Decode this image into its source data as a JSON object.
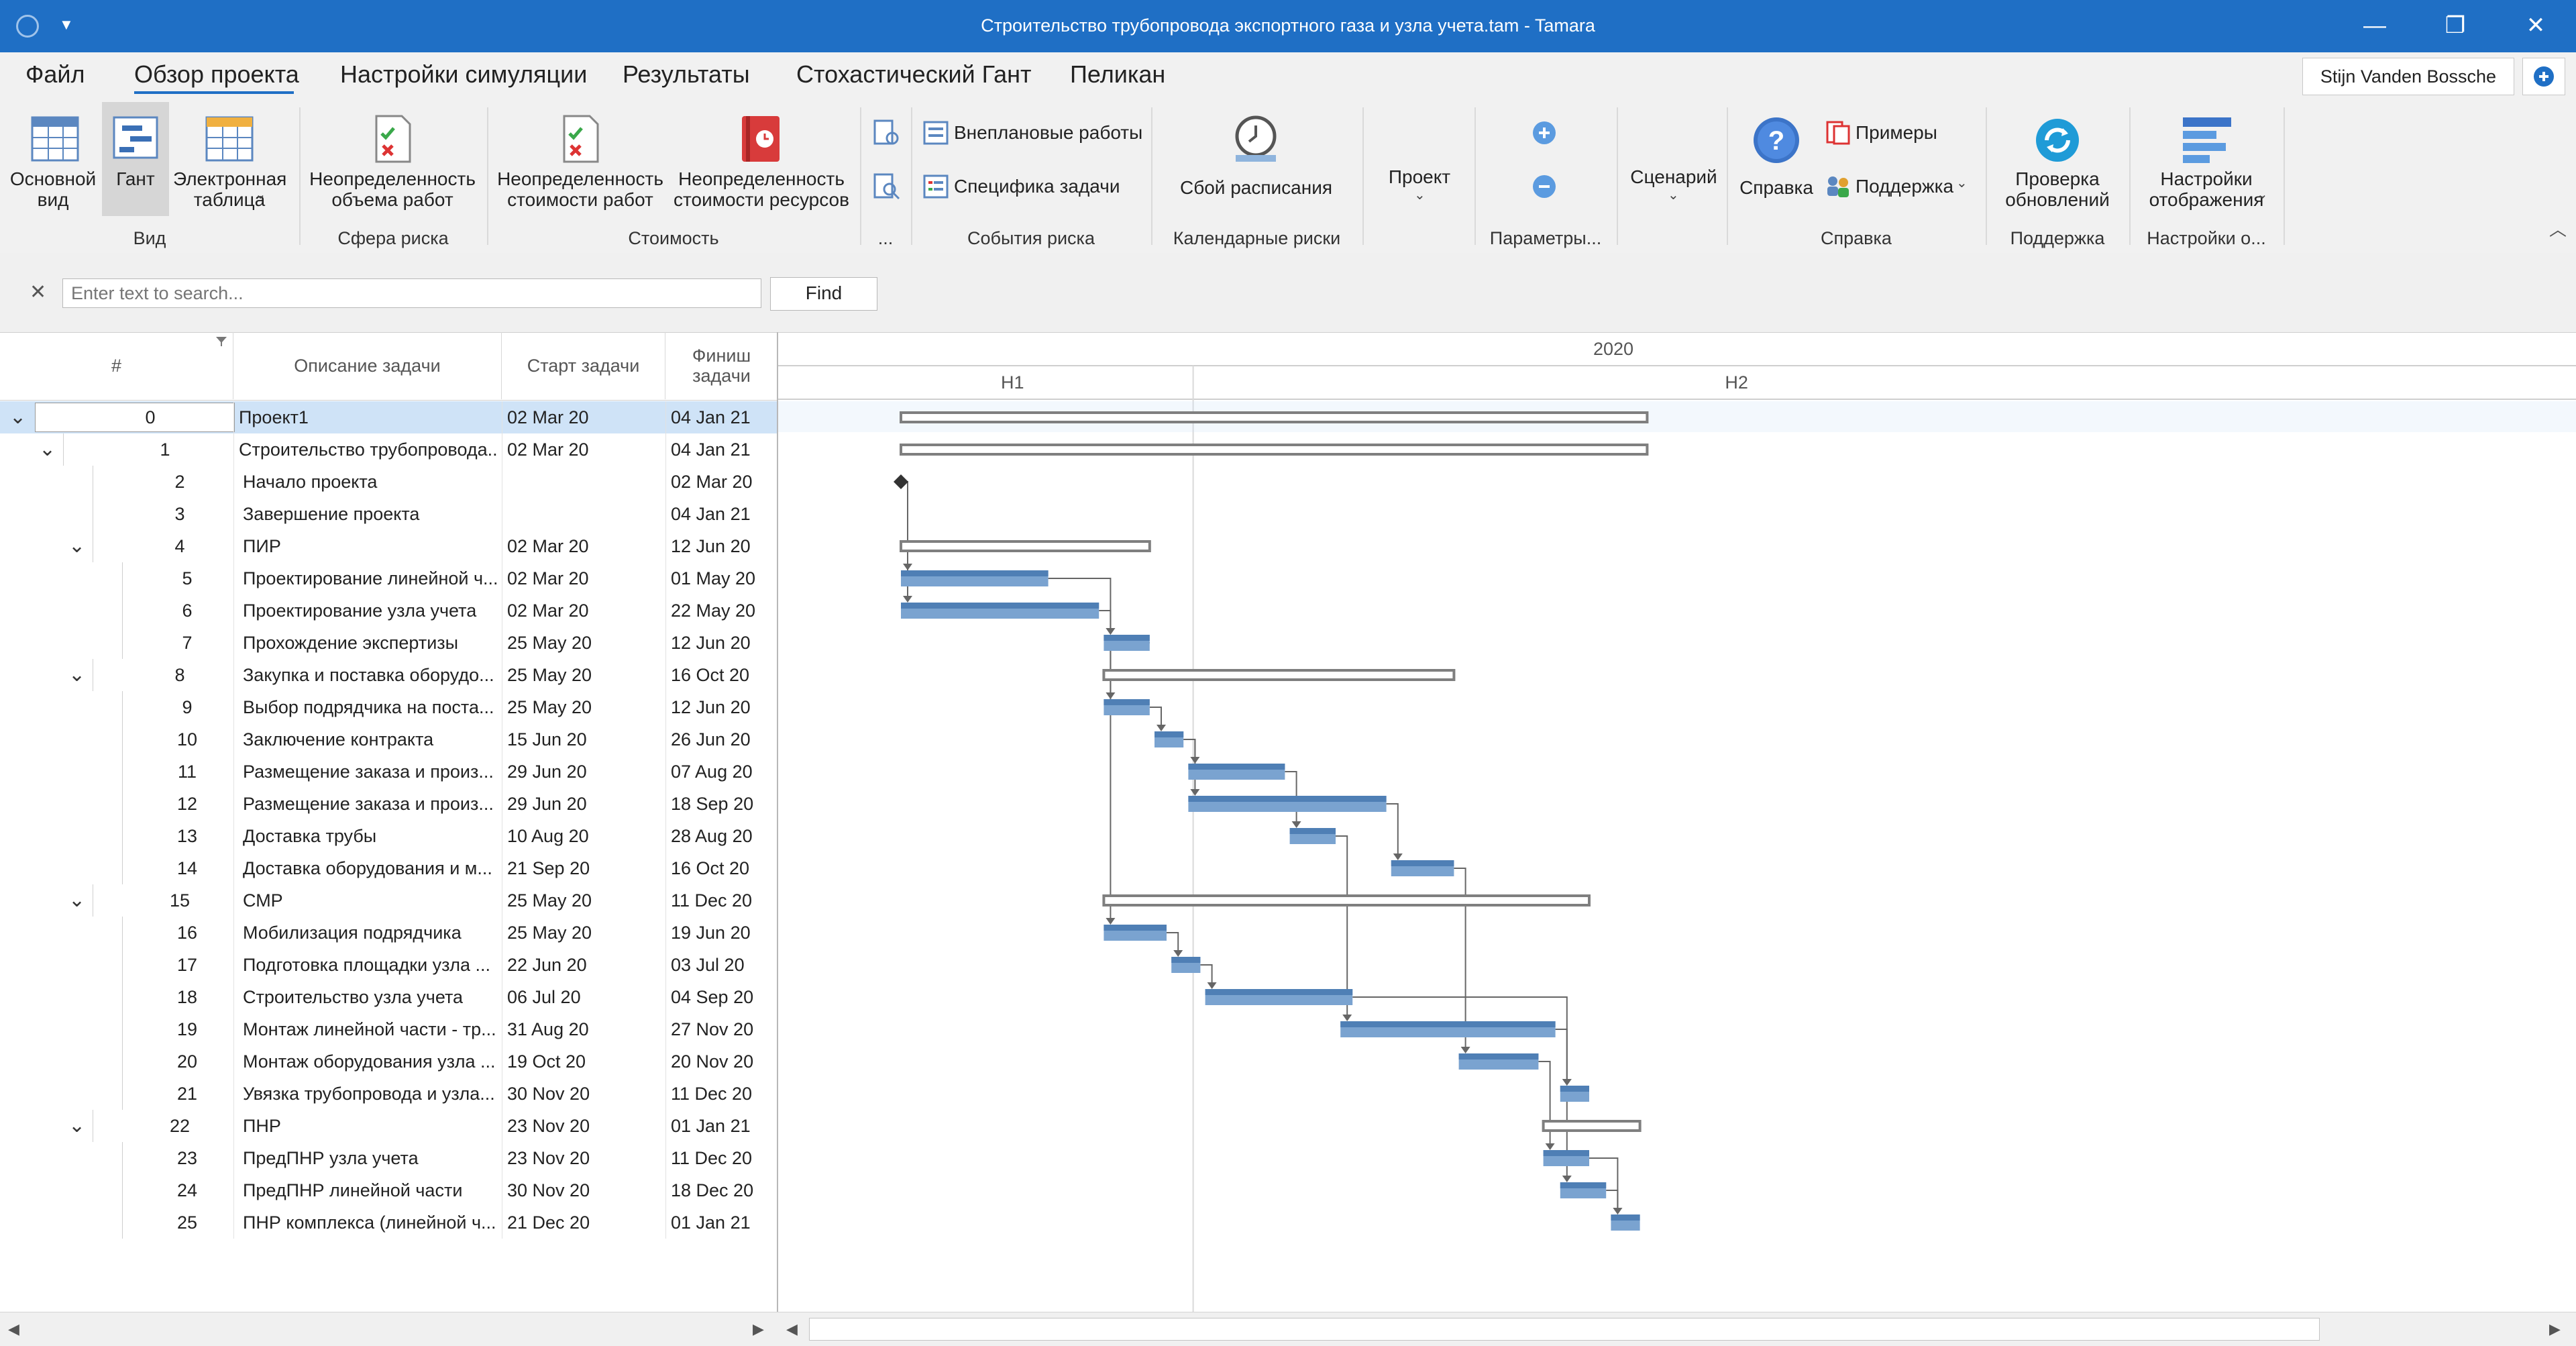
{
  "window": {
    "title": "Строительство трубопровода экспортного газа и узла учета.tam - Tamara",
    "minimize": "—",
    "restore": "❐",
    "close": "✕"
  },
  "menu": {
    "items": [
      "Файл",
      "Обзор проекта",
      "Настройки симуляции",
      "Результаты",
      "Стохастический Гант",
      "Пеликан"
    ],
    "active": "Обзор проекта",
    "user": "Stijn Vanden Bossche"
  },
  "ribbon": {
    "buttons": {
      "basic_view": "Основной\nвид",
      "gantt": "Гант",
      "spreadsheet": "Электронная\nтаблица",
      "work_uncertainty": "Неопределенность\nобъема работ",
      "cost_uncertainty": "Неопределенность\nстоимости работ",
      "resource_uncertainty": "Неопределенность\nстоимости ресурсов",
      "unplanned_works": "Внеплановые работы",
      "task_specifics": "Специфика задачи",
      "schedule_failure": "Сбой расписания",
      "project": "Проект",
      "scenario": "Сценарий",
      "help": "Справка",
      "examples": "Примеры",
      "support": "Поддержка",
      "check_updates": "Проверка\nобновлений",
      "display_settings": "Настройки\nотображения"
    },
    "groups": {
      "view": "Вид",
      "risk_area": "Сфера риска",
      "cost": "Стоимость",
      "dots": "...",
      "risk_events": "События риска",
      "calendar_risks": "Календарные риски",
      "parameters": "Параметры...",
      "help": "Справка",
      "support": "Поддержка",
      "display": "Настройки о..."
    }
  },
  "search": {
    "placeholder": "Enter text to search...",
    "find": "Find",
    "clear": "✕"
  },
  "grid": {
    "columns": {
      "num": "#",
      "desc": "Описание задачи",
      "start": "Старт задачи",
      "finish": "Финиш\nзадачи"
    },
    "rows": [
      {
        "id": "0",
        "level": 0,
        "desc": "Проект1",
        "start": "02 Mar 20",
        "finish": "04 Jan 21",
        "expand": true
      },
      {
        "id": "1",
        "level": 1,
        "desc": "Строительство трубопровода...",
        "start": "02 Mar 20",
        "finish": "04 Jan 21",
        "expand": true
      },
      {
        "id": "2",
        "level": 2,
        "desc": "Начало проекта",
        "start": "",
        "finish": "02 Mar 20",
        "expand": false
      },
      {
        "id": "3",
        "level": 2,
        "desc": "Завершение проекта",
        "start": "",
        "finish": "04 Jan 21",
        "expand": false
      },
      {
        "id": "4",
        "level": 2,
        "desc": "ПИР",
        "start": "02 Mar 20",
        "finish": "12 Jun 20",
        "expand": true
      },
      {
        "id": "5",
        "level": 3,
        "desc": "Проектирование линейной ч...",
        "start": "02 Mar 20",
        "finish": "01 May 20",
        "expand": false
      },
      {
        "id": "6",
        "level": 3,
        "desc": "Проектирование узла учета",
        "start": "02 Mar 20",
        "finish": "22 May 20",
        "expand": false
      },
      {
        "id": "7",
        "level": 3,
        "desc": "Прохождение экспертизы",
        "start": "25 May 20",
        "finish": "12 Jun 20",
        "expand": false
      },
      {
        "id": "8",
        "level": 2,
        "desc": "Закупка и поставка оборудо...",
        "start": "25 May 20",
        "finish": "16 Oct 20",
        "expand": true
      },
      {
        "id": "9",
        "level": 3,
        "desc": "Выбор подрядчика на поста...",
        "start": "25 May 20",
        "finish": "12 Jun 20",
        "expand": false
      },
      {
        "id": "10",
        "level": 3,
        "desc": "Заключение контракта",
        "start": "15 Jun 20",
        "finish": "26 Jun 20",
        "expand": false
      },
      {
        "id": "11",
        "level": 3,
        "desc": "Размещение заказа и произ...",
        "start": "29 Jun 20",
        "finish": "07 Aug 20",
        "expand": false
      },
      {
        "id": "12",
        "level": 3,
        "desc": "Размещение заказа и произ...",
        "start": "29 Jun 20",
        "finish": "18 Sep 20",
        "expand": false
      },
      {
        "id": "13",
        "level": 3,
        "desc": "Доставка трубы",
        "start": "10 Aug 20",
        "finish": "28 Aug 20",
        "expand": false
      },
      {
        "id": "14",
        "level": 3,
        "desc": "Доставка оборудования и м...",
        "start": "21 Sep 20",
        "finish": "16 Oct 20",
        "expand": false
      },
      {
        "id": "15",
        "level": 2,
        "desc": "СМР",
        "start": "25 May 20",
        "finish": "11 Dec 20",
        "expand": true
      },
      {
        "id": "16",
        "level": 3,
        "desc": "Мобилизация подрядчика",
        "start": "25 May 20",
        "finish": "19 Jun 20",
        "expand": false
      },
      {
        "id": "17",
        "level": 3,
        "desc": "Подготовка площадки узла ...",
        "start": "22 Jun 20",
        "finish": "03 Jul 20",
        "expand": false
      },
      {
        "id": "18",
        "level": 3,
        "desc": "Строительство узла учета",
        "start": "06 Jul 20",
        "finish": "04 Sep 20",
        "expand": false
      },
      {
        "id": "19",
        "level": 3,
        "desc": "Монтаж линейной части - тр...",
        "start": "31 Aug 20",
        "finish": "27 Nov 20",
        "expand": false
      },
      {
        "id": "20",
        "level": 3,
        "desc": "Монтаж оборудования узла ...",
        "start": "19 Oct 20",
        "finish": "20 Nov 20",
        "expand": false
      },
      {
        "id": "21",
        "level": 3,
        "desc": "Увязка трубопровода и узла...",
        "start": "30 Nov 20",
        "finish": "11 Dec 20",
        "expand": false
      },
      {
        "id": "22",
        "level": 2,
        "desc": "ПНР",
        "start": "23 Nov 20",
        "finish": "01 Jan 21",
        "expand": true
      },
      {
        "id": "23",
        "level": 3,
        "desc": "ПредПНР узла учета",
        "start": "23 Nov 20",
        "finish": "11 Dec 20",
        "expand": false
      },
      {
        "id": "24",
        "level": 3,
        "desc": "ПредПНР линейной части",
        "start": "30 Nov 20",
        "finish": "18 Dec 20",
        "expand": false
      },
      {
        "id": "25",
        "level": 3,
        "desc": "ПНР комплекса (линейной ч...",
        "start": "21 Dec 20",
        "finish": "01 Jan 21",
        "expand": false
      }
    ]
  },
  "gantt": {
    "year": "2020",
    "half1": "H1",
    "half2": "H2"
  },
  "colors": {
    "titlebar": "#1f6fc5",
    "bar": "#7aa3d0",
    "bar_dark": "#4f7fb5",
    "selected_row": "#cfe3f7"
  }
}
